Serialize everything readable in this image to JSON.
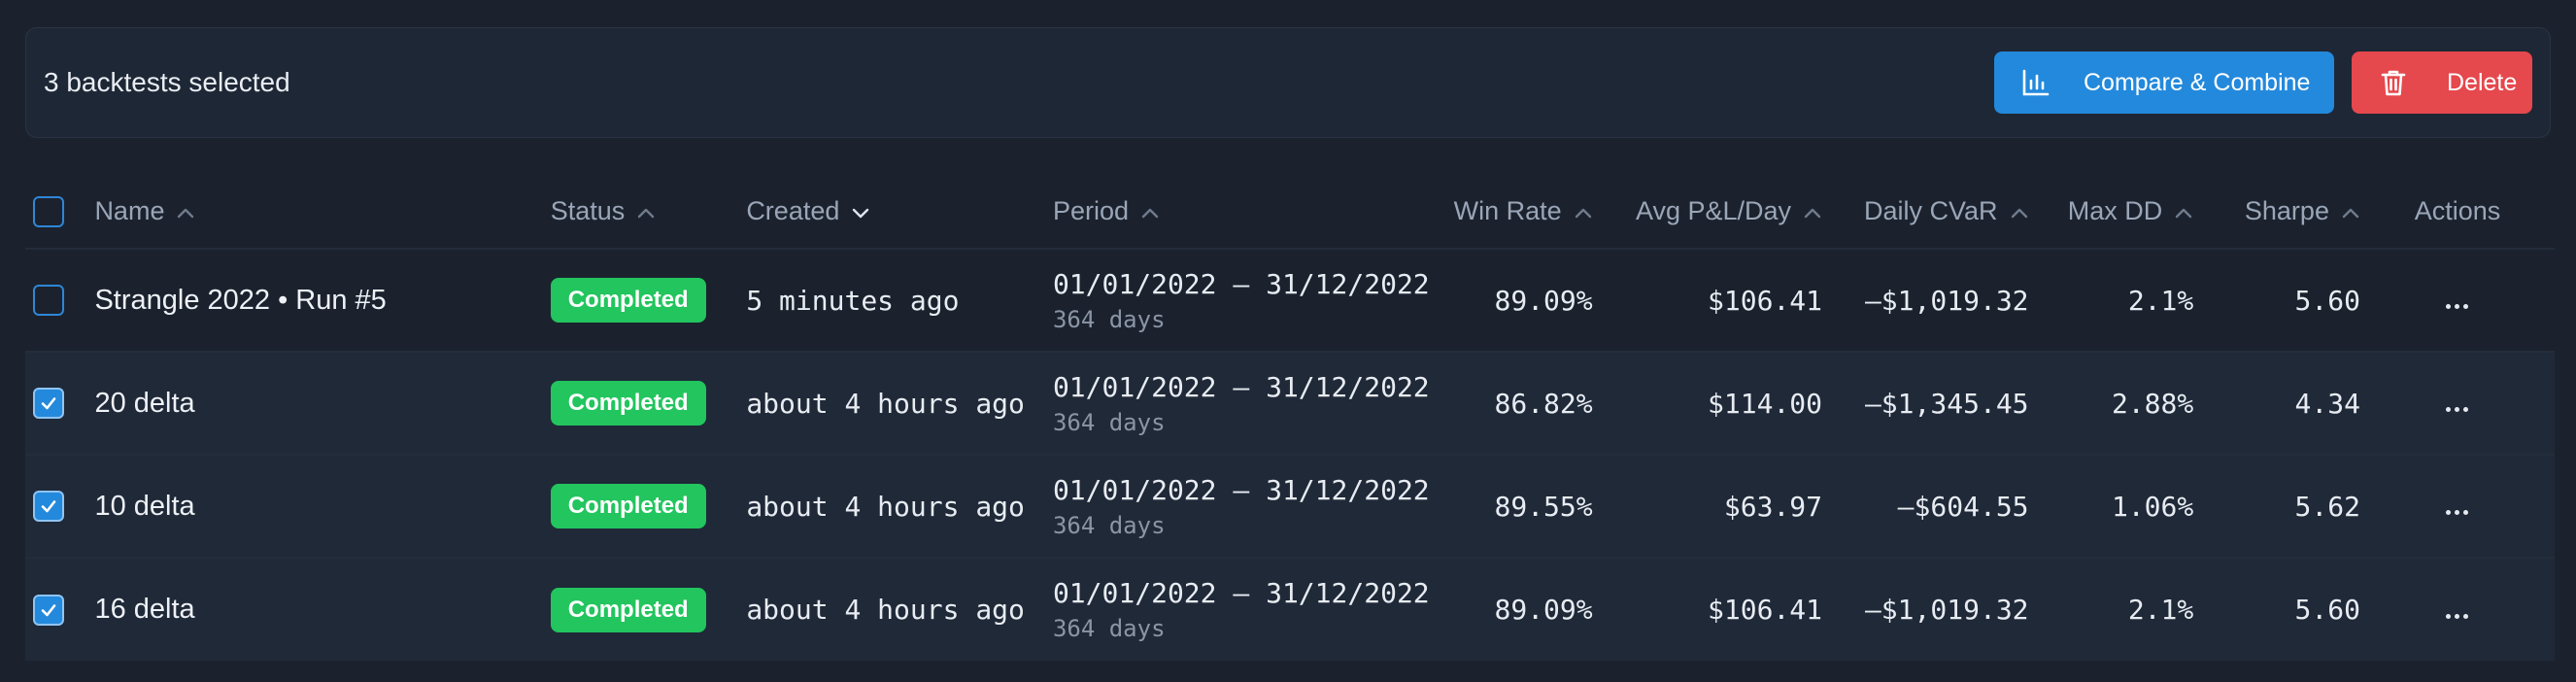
{
  "selection": {
    "text": "3 backtests selected",
    "compare_label": "Compare & Combine",
    "delete_label": "Delete"
  },
  "columns": {
    "name": "Name",
    "status": "Status",
    "created": "Created",
    "period": "Period",
    "win_rate": "Win Rate",
    "avg_pnl": "Avg P&L/Day",
    "cvar": "Daily CVaR",
    "max_dd": "Max DD",
    "sharpe": "Sharpe",
    "actions": "Actions"
  },
  "rows": [
    {
      "checked": false,
      "name": "Strangle 2022 • Run #5",
      "status": "Completed",
      "created": "5 minutes ago",
      "period": "01/01/2022 – 31/12/2022",
      "days": "364 days",
      "win_rate": "89.09%",
      "avg_pnl": "$106.41",
      "cvar": "–$1,019.32",
      "max_dd": "2.1%",
      "sharpe": "5.60"
    },
    {
      "checked": true,
      "name": "20 delta",
      "status": "Completed",
      "created": "about 4 hours ago",
      "period": "01/01/2022 – 31/12/2022",
      "days": "364 days",
      "win_rate": "86.82%",
      "avg_pnl": "$114.00",
      "cvar": "–$1,345.45",
      "max_dd": "2.88%",
      "sharpe": "4.34"
    },
    {
      "checked": true,
      "name": "10 delta",
      "status": "Completed",
      "created": "about 4 hours ago",
      "period": "01/01/2022 – 31/12/2022",
      "days": "364 days",
      "win_rate": "89.55%",
      "avg_pnl": "$63.97",
      "cvar": "–$604.55",
      "max_dd": "1.06%",
      "sharpe": "5.62"
    },
    {
      "checked": true,
      "name": "16 delta",
      "status": "Completed",
      "created": "about 4 hours ago",
      "period": "01/01/2022 – 31/12/2022",
      "days": "364 days",
      "win_rate": "89.09%",
      "avg_pnl": "$106.41",
      "cvar": "–$1,019.32",
      "max_dd": "2.1%",
      "sharpe": "5.60"
    }
  ],
  "colors": {
    "accent": "#2389dc",
    "danger": "#e5484d",
    "success": "#22c55e"
  }
}
